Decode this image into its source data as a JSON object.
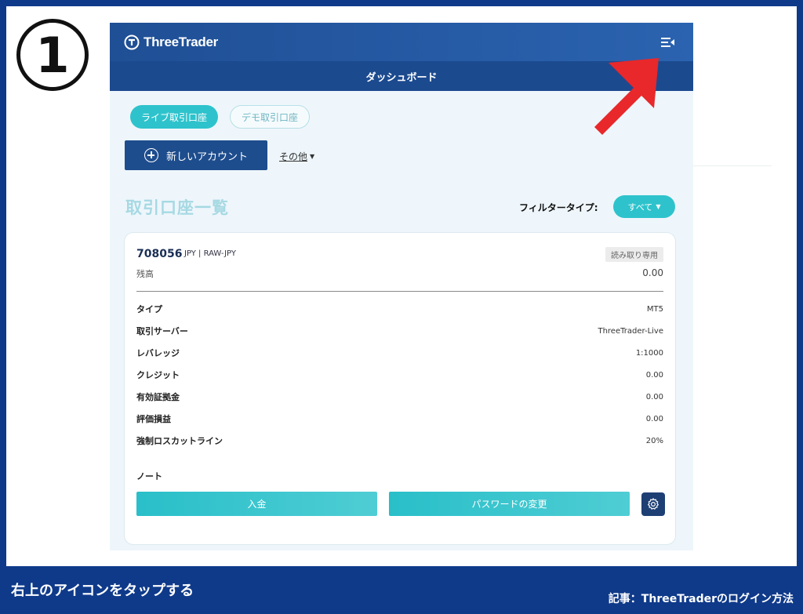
{
  "step": {
    "number": "1"
  },
  "header": {
    "brand": "ThreeTrader",
    "brand_icon": "threetrader-logo-icon",
    "menu_icon": "menu-collapse-icon"
  },
  "subheader": {
    "title": "ダッシュボード"
  },
  "account_tabs": [
    {
      "label": "ライブ取引口座",
      "active": true
    },
    {
      "label": "デモ取引口座",
      "active": false
    }
  ],
  "actions": {
    "new_account": "新しいアカウント",
    "others": "その他"
  },
  "list": {
    "title": "取引口座一覧",
    "filter_label": "フィルタータイプ:",
    "filter_value": "すべて"
  },
  "account": {
    "id": "708056",
    "meta": "JPY | RAW-JPY",
    "badge": "読み取り専用",
    "balance_label": "残高",
    "balance_value": "0.00",
    "details": [
      {
        "label": "タイプ",
        "value": "MT5"
      },
      {
        "label": "取引サーバー",
        "value": "ThreeTrader-Live"
      },
      {
        "label": "レバレッジ",
        "value": "1:1000"
      },
      {
        "label": "クレジット",
        "value": "0.00"
      },
      {
        "label": "有効証拠金",
        "value": "0.00"
      },
      {
        "label": "評価損益",
        "value": "0.00"
      },
      {
        "label": "強制ロスカットライン",
        "value": "20%"
      }
    ],
    "note_label": "ノート",
    "deposit_button": "入金",
    "password_button": "パスワードの変更"
  },
  "caption": {
    "left": "右上のアイコンをタップする",
    "right": "記事：ThreeTraderのログイン方法"
  },
  "colors": {
    "frame": "#0f3a8a",
    "teal": "#2ec3cc",
    "navy": "#1e4d8d",
    "arrow": "#e8282b"
  }
}
